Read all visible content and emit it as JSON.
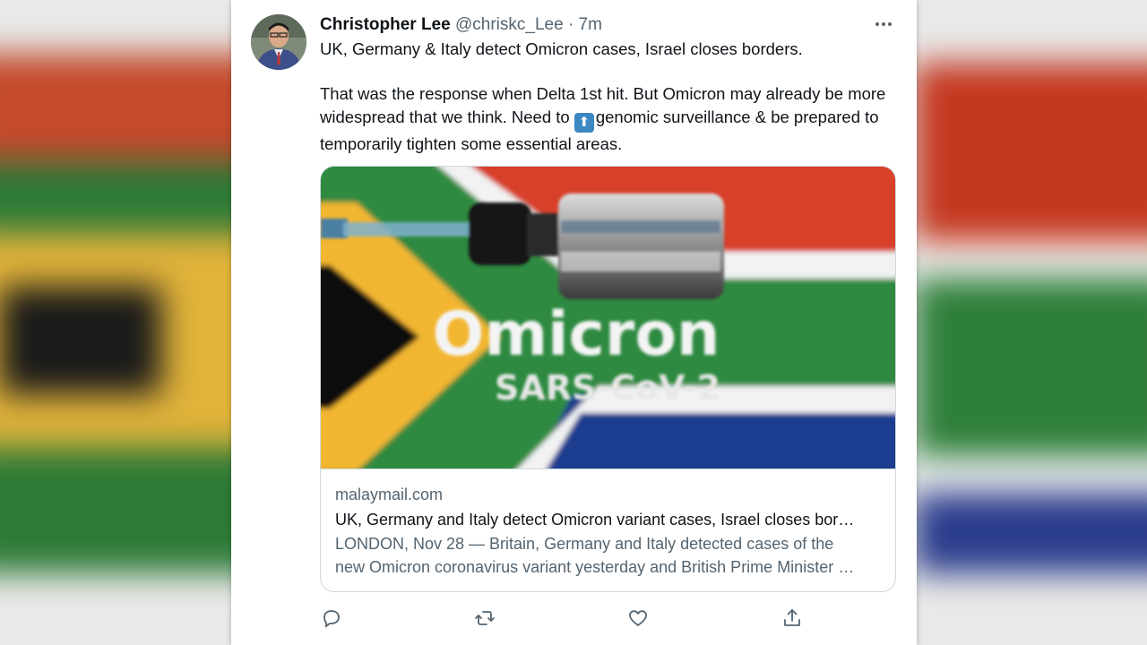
{
  "tweet": {
    "author_name": "Christopher Lee",
    "author_handle": "@chriskc_Lee",
    "separator": "·",
    "time": "7m",
    "text_line1": "UK, Germany & Italy detect Omicron cases, Israel closes borders.",
    "text_para2_before": "That was the response when Delta 1st hit. But Omicron may already be more widespread that we think. Need to ",
    "text_para2_emoji": "⬆",
    "text_para2_after": "genomic surveillance & be prepared to temporarily tighten some essential areas."
  },
  "link_card": {
    "image_text_main": "Omicron",
    "image_text_sub": "SARS-CoV-2",
    "domain": "malaymail.com",
    "title": "UK, Germany and Italy detect Omicron variant cases, Israel closes bor…",
    "description_line1": "LONDON, Nov 28 — Britain, Germany and Italy detected cases of the",
    "description_line2": "new Omicron coronavirus variant yesterday and British Prime Minister …"
  },
  "actions": [
    "reply-icon",
    "retweet-icon",
    "like-icon",
    "share-icon"
  ],
  "colors": {
    "text_primary": "#0f1419",
    "text_secondary": "#536471",
    "border": "#cfd9de",
    "emoji_blue": "#3b88c3",
    "flag_red": "#d8402c",
    "flag_green": "#2f8a3f",
    "flag_blue": "#1f3c8f",
    "flag_yellow": "#f2b632"
  }
}
